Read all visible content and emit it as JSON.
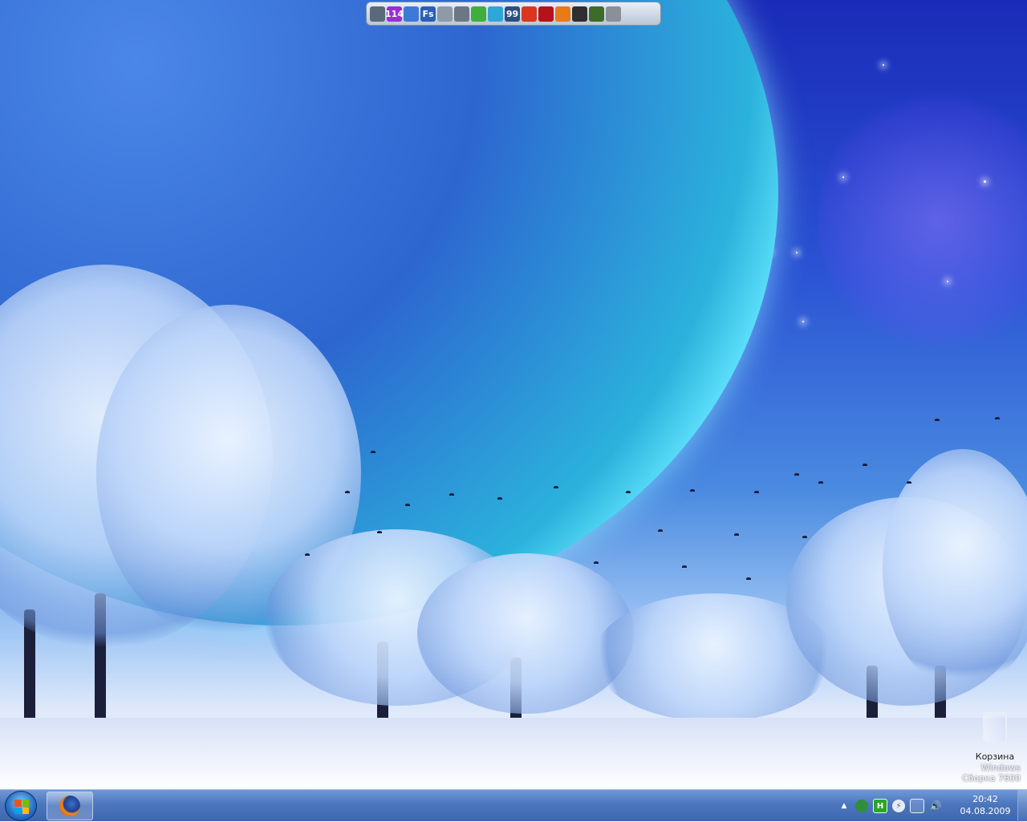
{
  "app_bar": {
    "items": [
      {
        "icon": "tools-icon",
        "label": "",
        "color": "#5a6a7a"
      },
      {
        "icon": "number-114-icon",
        "label": "114",
        "color": "#9a2fd0"
      },
      {
        "icon": "pen-icon",
        "label": "",
        "color": "#3d7ad8"
      },
      {
        "icon": "fs-icon",
        "label": "Fs",
        "color": "#2b5fb6"
      },
      {
        "icon": "disk-icon",
        "label": "",
        "color": "#8e9aa8"
      },
      {
        "icon": "pencil-icon",
        "label": "",
        "color": "#6d7683"
      },
      {
        "icon": "leaf-icon",
        "label": "",
        "color": "#3fae3c"
      },
      {
        "icon": "landscape-icon",
        "label": "",
        "color": "#2ea6d6"
      },
      {
        "icon": "monitor-99-icon",
        "label": "99",
        "color": "#2b4f7f"
      },
      {
        "icon": "flash-icon",
        "label": "",
        "color": "#d9381e"
      },
      {
        "icon": "acrobat-icon",
        "label": "",
        "color": "#b5131a"
      },
      {
        "icon": "menu-circle-icon",
        "label": "",
        "color": "#e87b16"
      },
      {
        "icon": "winamp-icon",
        "label": "",
        "color": "#2f2f2f"
      },
      {
        "icon": "game-icon",
        "label": "",
        "color": "#3c6b2a"
      },
      {
        "icon": "bell-icon",
        "label": "",
        "color": "#8a8f98"
      }
    ]
  },
  "desktop": {
    "recycle_bin_label": "Корзина",
    "watermark_line1": "Windows",
    "watermark_line2": "Сборка 7600"
  },
  "taskbar": {
    "start_icon": "windows-start-icon",
    "pinned": [
      {
        "name": "firefox",
        "icon": "firefox-icon"
      }
    ],
    "tray_icons": [
      "show-hidden-icon",
      "shield-icon",
      "green-h-icon",
      "flash-tray-icon",
      "network-icon",
      "volume-icon"
    ],
    "time": "20:42",
    "date": "04.08.2009"
  }
}
